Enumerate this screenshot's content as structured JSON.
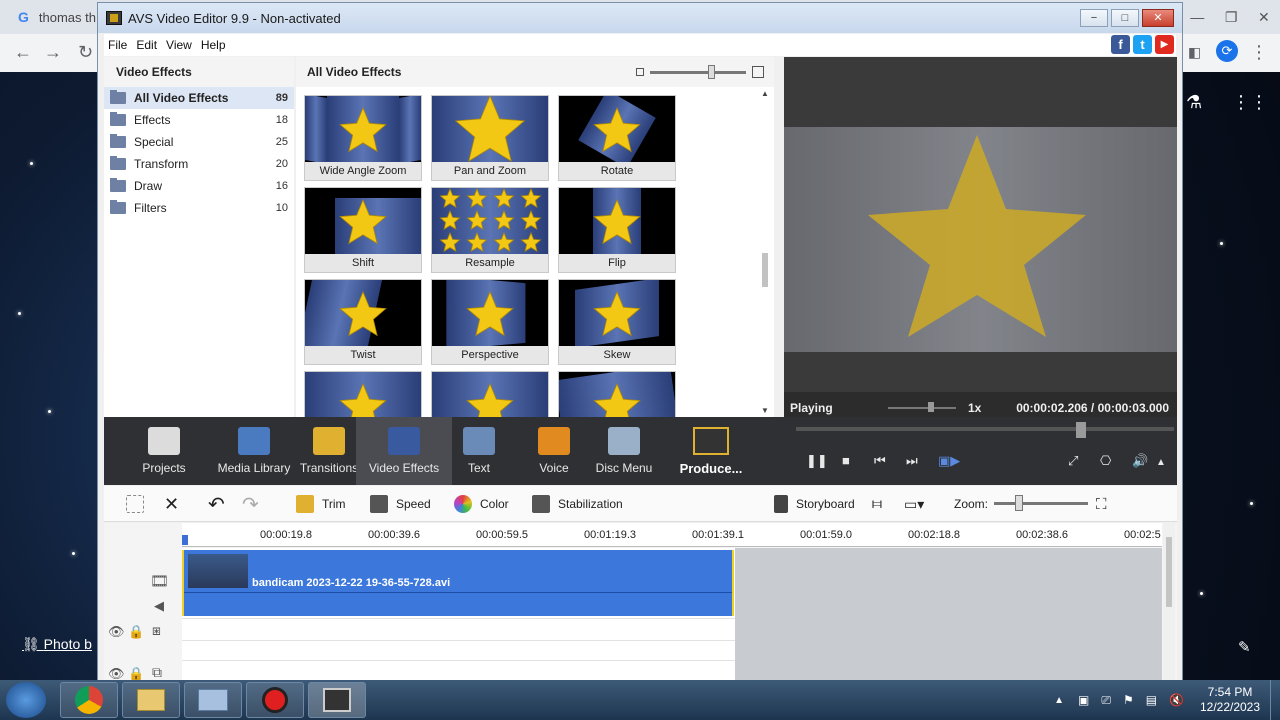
{
  "browser": {
    "tab_text": "thomas th",
    "photo_link": "Photo b"
  },
  "window": {
    "title": "AVS Video Editor 9.9 - Non-activated",
    "minimize": "−",
    "maximize": "□",
    "close": "✕"
  },
  "menu": [
    "File",
    "Edit",
    "View",
    "Help"
  ],
  "social": {
    "facebook": "f",
    "twitter": "t",
    "youtube": "▶",
    "colors": {
      "facebook": "#3b5998",
      "twitter": "#1da1f2",
      "youtube": "#e02a20"
    }
  },
  "left_panel": {
    "header": "Video Effects",
    "items": [
      {
        "label": "All Video Effects",
        "count": "89",
        "selected": true
      },
      {
        "label": "Effects",
        "count": "18"
      },
      {
        "label": "Special",
        "count": "25"
      },
      {
        "label": "Transform",
        "count": "20"
      },
      {
        "label": "Draw",
        "count": "16"
      },
      {
        "label": "Filters",
        "count": "10"
      }
    ]
  },
  "grid_panel": {
    "header": "All Video Effects",
    "tiles": [
      {
        "label": "Wide Angle Zoom"
      },
      {
        "label": "Pan and Zoom"
      },
      {
        "label": "Rotate"
      },
      {
        "label": "Shift"
      },
      {
        "label": "Resample"
      },
      {
        "label": "Flip"
      },
      {
        "label": "Twist"
      },
      {
        "label": "Perspective"
      },
      {
        "label": "Skew"
      },
      {
        "label": ""
      },
      {
        "label": ""
      },
      {
        "label": ""
      }
    ]
  },
  "preview": {
    "status": "Playing",
    "speed": "1x",
    "timecode": "00:00:02.206 / 00:00:03.000",
    "seek_position": 0.74
  },
  "mode_bar": {
    "items": [
      {
        "label": "Projects",
        "color": "#dcdcdc"
      },
      {
        "label": "Media Library",
        "color": "#4a7ac0"
      },
      {
        "label": "Transitions",
        "color": "#e0b030"
      },
      {
        "label": "Video Effects",
        "color": "#3a5aa0",
        "active": true
      },
      {
        "label": "Text",
        "color": "#6a8ab8"
      },
      {
        "label": "Voice",
        "color": "#e08a20"
      },
      {
        "label": "Disc Menu",
        "color": "#9ab0c8"
      }
    ],
    "produce": "Produce..."
  },
  "edit_bar": {
    "trim": "Trim",
    "speed": "Speed",
    "color": "Color",
    "stabilization": "Stabilization",
    "storyboard": "Storyboard",
    "zoom": "Zoom:"
  },
  "timeline": {
    "ticks": [
      "00:00:19.8",
      "00:00:39.6",
      "00:00:59.5",
      "00:01:19.3",
      "00:01:39.1",
      "00:01:59.0",
      "00:02:18.8",
      "00:02:38.6",
      "00:02:5"
    ],
    "clip_name": "bandicam 2023-12-22 19-36-55-728.avi"
  },
  "taskbar": {
    "time": "7:54 PM",
    "date": "12/22/2023"
  }
}
